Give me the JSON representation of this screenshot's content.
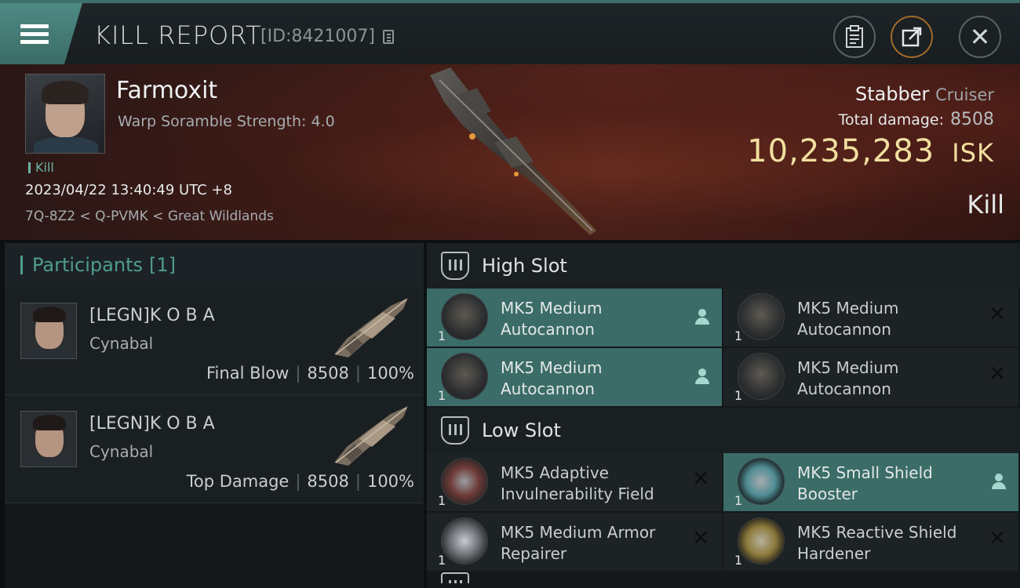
{
  "header": {
    "title": "KILL REPORT",
    "report_id": "[ID:8421007]"
  },
  "victim": {
    "name": "Farmoxit",
    "sub": "Warp Soramble Strength: 4.0",
    "tag": "Kill",
    "time": "2023/04/22 13:40:49 UTC +8",
    "location": "7Q-8Z2 < Q-PVMK < Great Wildlands",
    "ship_name": "Stabber",
    "ship_class": "Cruiser",
    "total_damage_label": "Total damage:",
    "total_damage": "8508",
    "isk_value": "10,235,283",
    "isk_unit": "ISK",
    "result": "Kill"
  },
  "participants": {
    "label": "Participants",
    "count": "[1]",
    "items": [
      {
        "name": "[LEGN]K O B A",
        "ship": "Cynabal",
        "role": "Final Blow",
        "damage": "8508",
        "percent": "100%"
      },
      {
        "name": "[LEGN]K O B A",
        "ship": "Cynabal",
        "role": "Top Damage",
        "damage": "8508",
        "percent": "100%"
      }
    ]
  },
  "slots": {
    "high": {
      "title": "High Slot",
      "modules": [
        {
          "name": "MK5 Medium Autocannon",
          "qty": "1",
          "state": "dropped"
        },
        {
          "name": "MK5 Medium Autocannon",
          "qty": "1",
          "state": "destroyed"
        },
        {
          "name": "MK5 Medium Autocannon",
          "qty": "1",
          "state": "dropped"
        },
        {
          "name": "MK5 Medium Autocannon",
          "qty": "1",
          "state": "destroyed"
        }
      ]
    },
    "low": {
      "title": "Low Slot",
      "modules": [
        {
          "name": "MK5 Adaptive Invulnerability Field",
          "qty": "1",
          "state": "destroyed"
        },
        {
          "name": "MK5 Small Shield Booster",
          "qty": "1",
          "state": "dropped"
        },
        {
          "name": "MK5 Medium Armor Repairer",
          "qty": "1",
          "state": "destroyed"
        },
        {
          "name": "MK5 Reactive Shield Hardener",
          "qty": "1",
          "state": "destroyed"
        }
      ]
    }
  },
  "colors": {
    "accent": "#3b6c67",
    "isk": "#f1dfa0",
    "tag": "#6fb3a4"
  }
}
